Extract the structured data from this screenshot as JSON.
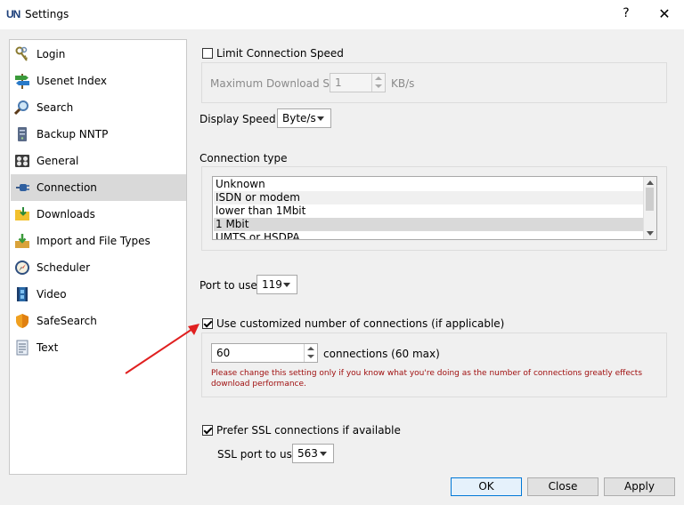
{
  "window": {
    "title": "Settings",
    "help_label": "?",
    "close_label": "✕",
    "logo_text": "UN"
  },
  "nav": {
    "items": [
      {
        "label": "Login",
        "icon": "keys-icon"
      },
      {
        "label": "Usenet Index",
        "icon": "signpost-icon"
      },
      {
        "label": "Search",
        "icon": "magnifier-icon"
      },
      {
        "label": "Backup NNTP",
        "icon": "server-icon"
      },
      {
        "label": "General",
        "icon": "general-icon"
      },
      {
        "label": "Connection",
        "icon": "connection-icon",
        "selected": true
      },
      {
        "label": "Downloads",
        "icon": "folder-icon"
      },
      {
        "label": "Import and File Types",
        "icon": "import-icon"
      },
      {
        "label": "Scheduler",
        "icon": "compass-icon"
      },
      {
        "label": "Video",
        "icon": "film-icon"
      },
      {
        "label": "SafeSearch",
        "icon": "shield-icon"
      },
      {
        "label": "Text",
        "icon": "document-icon"
      }
    ]
  },
  "connection": {
    "limit_speed_label": "Limit Connection Speed",
    "limit_speed_checked": false,
    "max_speed_label": "Maximum Download Speed",
    "max_speed_value": "1",
    "max_speed_unit": "KB/s",
    "display_speed_label": "Display Speed in:",
    "display_speed_value": "Byte/s",
    "connection_type_label": "Connection type",
    "connection_types": [
      "Unknown",
      "ISDN or modem",
      "lower than 1Mbit",
      "1 Mbit",
      "UMTS or HSDPA"
    ],
    "connection_type_selected": "1 Mbit",
    "port_label": "Port to use:",
    "port_value": "119",
    "custom_conn_label": "Use customized number of connections (if applicable)",
    "custom_conn_checked": true,
    "connections_value": "60",
    "connections_suffix": "connections (60 max)",
    "warning_text": "Please change this setting only if you know what you're doing as the number of connections greatly effects download performance.",
    "prefer_ssl_label": "Prefer SSL connections if available",
    "prefer_ssl_checked": true,
    "ssl_port_label": "SSL port to use:",
    "ssl_port_value": "563"
  },
  "buttons": {
    "ok": "OK",
    "close": "Close",
    "apply": "Apply"
  },
  "colors": {
    "annotation_arrow": "#e02020",
    "warning_text": "#a01010",
    "selection": "#d9d9d9"
  }
}
